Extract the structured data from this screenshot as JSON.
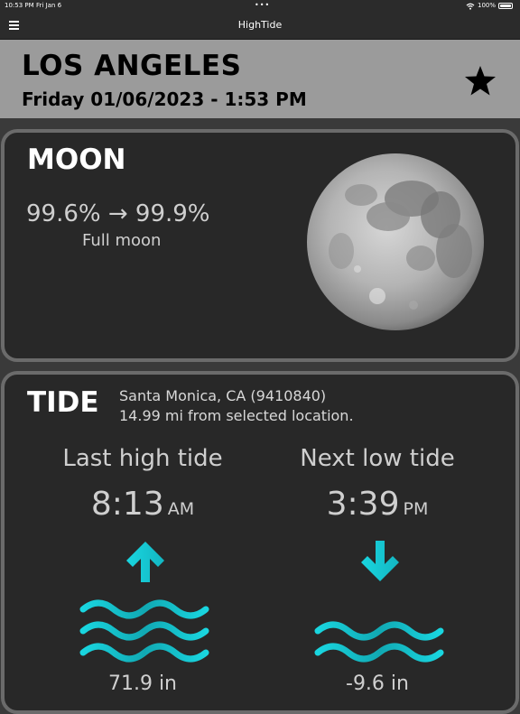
{
  "status": {
    "time": "10:53 PM",
    "date": "Fri Jan 6",
    "dots": "•••",
    "battery": "100%"
  },
  "nav": {
    "title": "HighTide"
  },
  "location": {
    "city": "LOS ANGELES",
    "datetime": "Friday 01/06/2023 - 1:53 PM"
  },
  "moon": {
    "title": "MOON",
    "illumination": "99.6% → 99.9%",
    "phase": "Full moon"
  },
  "tide": {
    "title": "TIDE",
    "station": "Santa Monica, CA (9410840)",
    "distance": "14.99 mi from selected location.",
    "last": {
      "label": "Last high tide",
      "time": "8:13",
      "ampm": "AM",
      "height": "71.9 in"
    },
    "next": {
      "label": "Next low tide",
      "time": "3:39",
      "ampm": "PM",
      "height": "-9.6 in"
    }
  },
  "colors": {
    "accent": "#19d6e0",
    "header_bg": "#9b9b9b",
    "card_bg": "#282828",
    "card_border": "#6b6b6b"
  }
}
